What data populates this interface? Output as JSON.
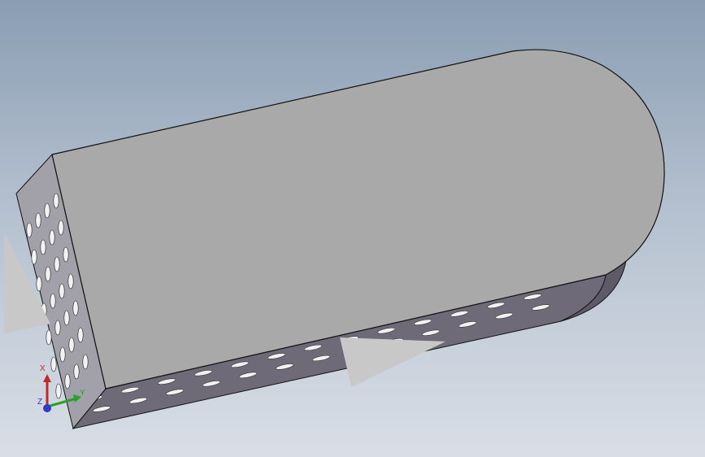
{
  "viewport": {
    "background_top": "#8a9db3",
    "background_bottom": "#d9dee6"
  },
  "model": {
    "top_face_color": "#a9a9a9",
    "side_face_color": "#6e6a78",
    "front_face_color": "#a2a0a8",
    "hole_color": "#f2f2f2",
    "edge_color": "#111111"
  },
  "triad": {
    "x_label": "X",
    "y_label": "Y",
    "z_label": "Z",
    "x_color": "#c0282d",
    "y_color": "#2aa02a",
    "z_color": "#2a3cc8"
  },
  "manipulators": {
    "arrow_color": "#c8c8c8",
    "icons": [
      "drag-arrow-left-icon",
      "drag-arrow-bottom-icon"
    ]
  }
}
